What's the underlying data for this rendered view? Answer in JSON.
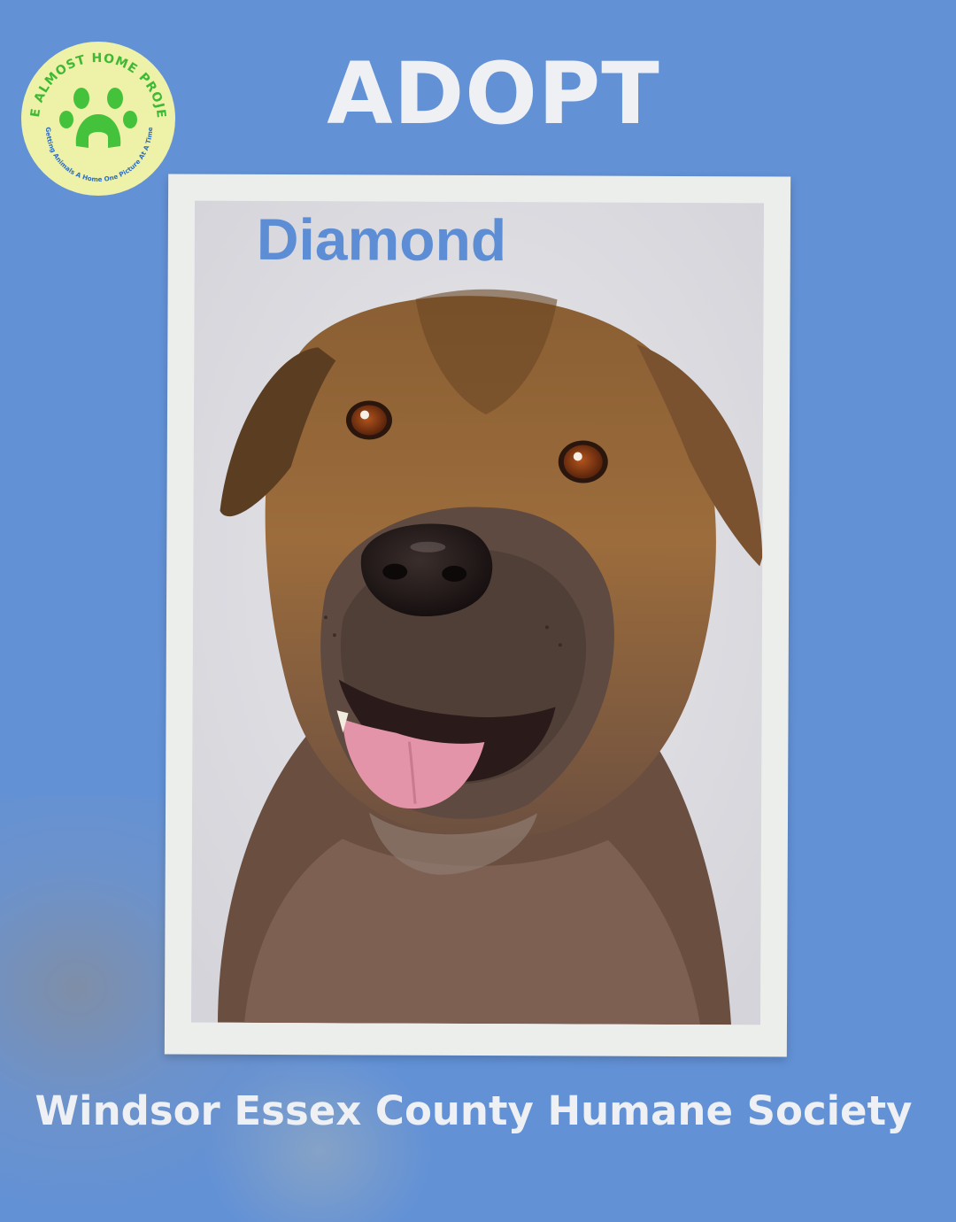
{
  "headline": "ADOPT",
  "pet": {
    "name": "Diamond",
    "photo_icon": "dog-portrait-icon"
  },
  "logo": {
    "name": "THE ALMOST HOME PROJECT",
    "tagline": "Getting Animals A Home One Picture At A Time",
    "icon": "paw-print-icon"
  },
  "organization": "Windsor Essex County Humane Society",
  "colors": {
    "background": "#6291d6",
    "headline": "#eef0f4",
    "pet_name": "#5d8ed5",
    "logo_fill": "#eef1a8",
    "logo_green": "#45c23c"
  }
}
